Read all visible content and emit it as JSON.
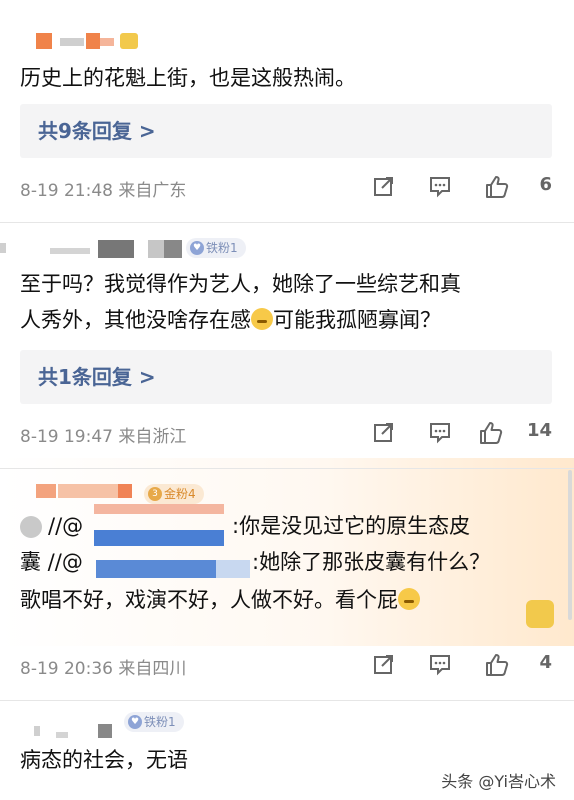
{
  "comments": [
    {
      "text_lines": [
        "历史上的花魁上街，也是这般热闹。"
      ],
      "reply_label": "共9条回复 >",
      "time": "8-19 21:48",
      "source": "来自广东",
      "likes": "6"
    },
    {
      "badge": "铁粉1",
      "text_lines": [
        "至于吗？我觉得作为艺人，她除了一些综艺和真",
        "人秀外，其他没啥存在感",
        "可能我孤陋寡闻？"
      ],
      "reply_label": "共1条回复 >",
      "time": "8-19 19:47",
      "source": "来自浙江",
      "likes": "14"
    },
    {
      "badge": "金粉4",
      "text_lines": [
        ":你是没见过它的原生态皮",
        "囊 //@",
        ":她除了那张皮囊有什么？",
        "歌唱不好，戏演不好，人做不好。看个屁"
      ],
      "time": "8-19 20:36",
      "source": "来自四川",
      "likes": "4"
    },
    {
      "badge": "铁粉1",
      "text_lines": [
        "病态的社会，无语"
      ]
    }
  ],
  "watermark": "头条 @Yi峇心术",
  "colors": {
    "reply_text": "#4a6595",
    "reply_bg": "#f4f4f5",
    "meta_text": "#8a8a8a",
    "badge_bg": "#eef0f6"
  },
  "icons": [
    "share-icon",
    "comment-icon",
    "like-icon"
  ]
}
